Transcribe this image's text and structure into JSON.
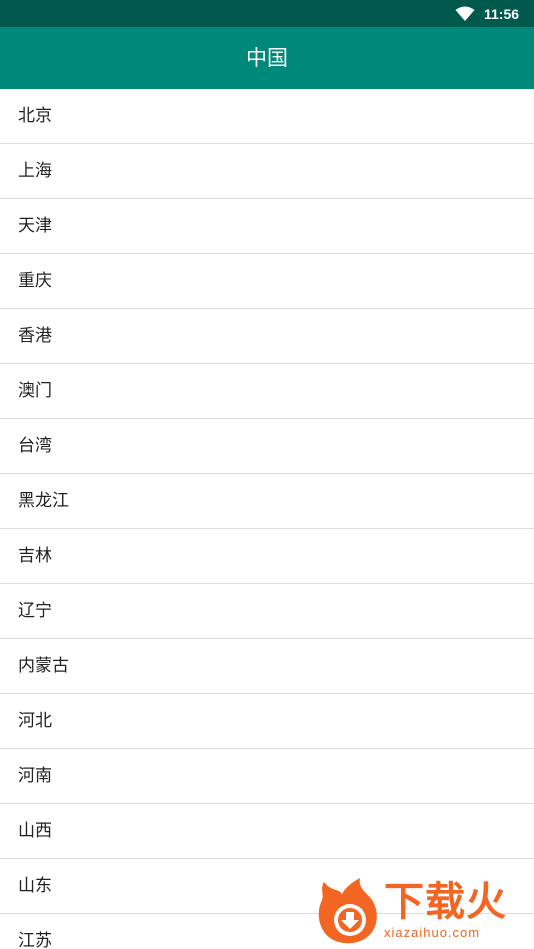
{
  "status_bar": {
    "time": "11:56",
    "wifi_icon": "wifi-icon"
  },
  "app_bar": {
    "title": "中国"
  },
  "provinces": [
    {
      "label": "北京"
    },
    {
      "label": "上海"
    },
    {
      "label": "天津"
    },
    {
      "label": "重庆"
    },
    {
      "label": "香港"
    },
    {
      "label": "澳门"
    },
    {
      "label": "台湾"
    },
    {
      "label": "黑龙江"
    },
    {
      "label": "吉林"
    },
    {
      "label": "辽宁"
    },
    {
      "label": "内蒙古"
    },
    {
      "label": "河北"
    },
    {
      "label": "河南"
    },
    {
      "label": "山西"
    },
    {
      "label": "山东"
    },
    {
      "label": "江苏"
    }
  ],
  "watermark": {
    "brand": "下载火",
    "url": "xiazaihuo.com",
    "icon": "flame-download-icon"
  },
  "colors": {
    "status_bar": "#00594c",
    "app_bar": "#00897b",
    "divider": "#dddddd",
    "watermark": "#f26522"
  }
}
